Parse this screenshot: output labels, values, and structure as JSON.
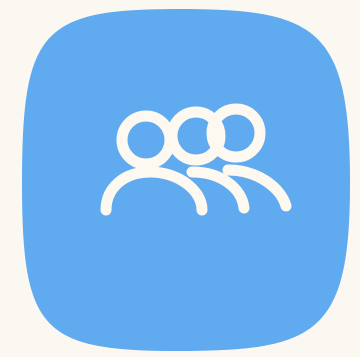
{
  "app_icon": {
    "icon": "people-group-icon",
    "colors": {
      "background": "#fbf7f1",
      "tile": "#60aaf0",
      "glyph": "#fdf8f0"
    }
  }
}
